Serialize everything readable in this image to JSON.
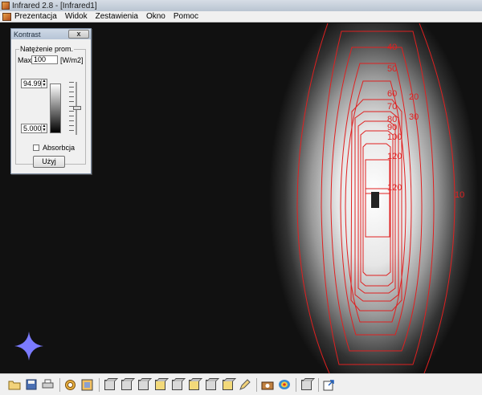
{
  "window": {
    "title": "Infrared 2.8 - [Infrared1]"
  },
  "menu": {
    "items": [
      "Prezentacja",
      "Widok",
      "Zestawienia",
      "Okno",
      "Pomoc"
    ]
  },
  "contrast_dialog": {
    "title": "Kontrast",
    "close_glyph": "x",
    "group_label": "Natężenie prom.",
    "max_label": "Max:",
    "max_value": "100",
    "unit": "[W/m2]",
    "upper_value": "94.99",
    "lower_value": "5.000",
    "absorption_label": "Absorbcja",
    "absorption_checked": false,
    "use_button": "Użyj"
  },
  "isolines": {
    "color": "#e02020",
    "labels": [
      "40",
      "50",
      "60",
      "20",
      "70",
      "30",
      "80",
      "90",
      "100",
      "120",
      "120",
      "10"
    ]
  },
  "toolbar": {
    "icons": [
      "open-folder-icon",
      "save-icon",
      "print-icon",
      "target-icon",
      "frame-icon",
      "cube-view-1-icon",
      "cube-view-2-icon",
      "cube-view-3-icon",
      "cube-view-4-icon",
      "cube-view-5-icon",
      "cube-view-6-icon",
      "cube-view-7-icon",
      "cube-view-8-icon",
      "camera-icon",
      "heatmap-icon",
      "cube-view-9-icon",
      "export-icon"
    ]
  }
}
